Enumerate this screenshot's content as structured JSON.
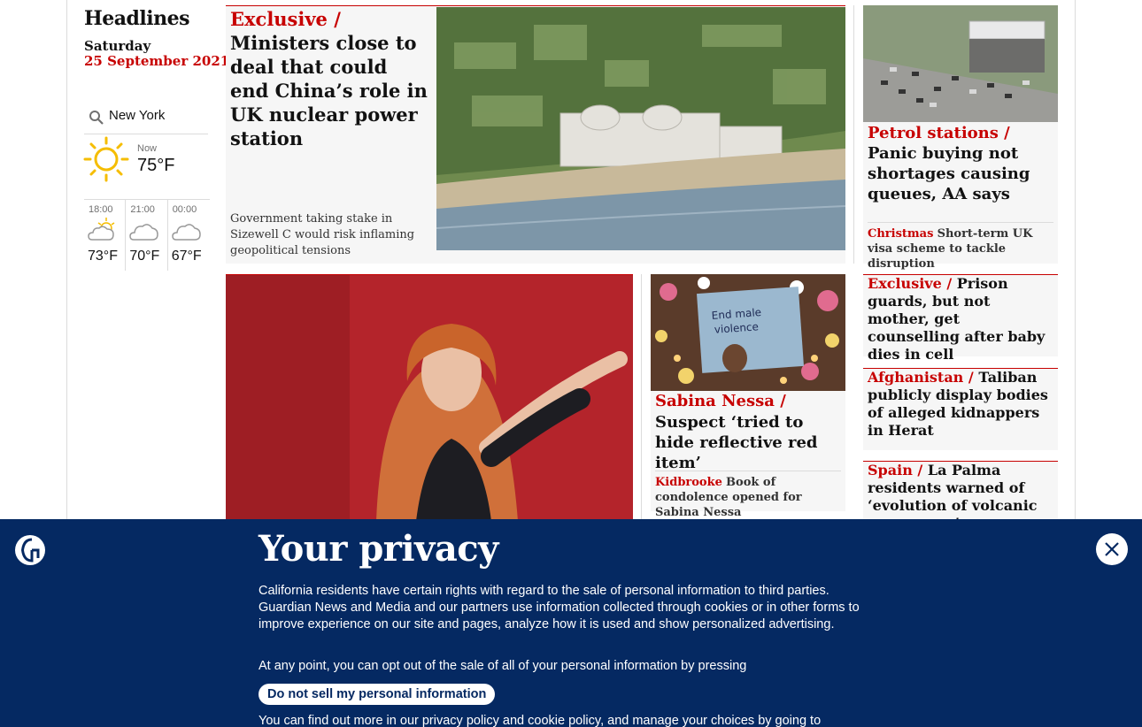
{
  "sidebar": {
    "title": "Headlines",
    "day": "Saturday",
    "date": "25 September 2021"
  },
  "weather": {
    "location": "New York",
    "now_label": "Now",
    "now_temp": "75°F",
    "forecast": [
      {
        "time": "18:00",
        "temp": "73°F",
        "icon": "partly-cloudy-icon"
      },
      {
        "time": "21:00",
        "temp": "70°F",
        "icon": "cloud-icon"
      },
      {
        "time": "00:00",
        "temp": "67°F",
        "icon": "cloud-icon"
      }
    ]
  },
  "lead": {
    "kicker": "Exclusive /",
    "headline": "Ministers close to deal that could end China’s role in UK nuclear power station",
    "standfirst": "Government taking stake in Sizewell C would risk inflaming geopolitical tensions"
  },
  "petrol": {
    "kicker": "Petrol stations /",
    "headline": "Panic buying not shortages causing queues, AA says",
    "sub_kicker": "Christmas",
    "sub_text": "Short-term UK visa scheme to tackle disruption"
  },
  "sabina": {
    "kicker": "Sabina Nessa  /",
    "headline": "Suspect ‘tried to hide reflective red item’",
    "sub_kicker": "Kidbrooke",
    "sub_text": "Book of condolence opened for Sabina Nessa",
    "sign_text": "End male violence"
  },
  "right_list": [
    {
      "kicker": "Exclusive /",
      "headline": "Prison guards, but not mother, get counselling after baby dies in cell"
    },
    {
      "kicker": "Afghanistan /",
      "headline": "Taliban publicly display bodies of alleged kidnappers in Herat"
    },
    {
      "kicker": "Spain /",
      "headline": "La Palma residents warned of ‘evolution of volcanic emergency’"
    }
  ],
  "privacy": {
    "title": "Your privacy",
    "para1": "California residents have certain rights with regard to the sale of personal information to third parties. Guardian News and Media and our partners use information collected through cookies or in other forms to improve experience on our site and pages, analyze how it is used and show personalized advertising.",
    "para2": "At any point, you can opt out of the sale of all of your personal information by pressing",
    "button": "Do not sell my personal information",
    "para3": "You can find out more in our privacy policy and cookie policy, and manage your choices by going to"
  },
  "colors": {
    "news_red": "#c70000",
    "brand_blue": "#052962",
    "card_bg": "#f6f6f6"
  }
}
